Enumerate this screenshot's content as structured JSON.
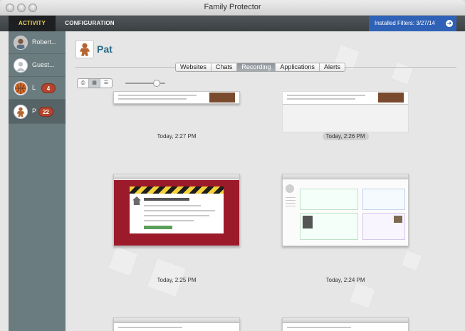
{
  "window": {
    "title": "Family Protector"
  },
  "nav": {
    "activity_label": "ACTIVITY",
    "configuration_label": "CONFIGURATION",
    "filters_banner": "Installed Filters: 3/27/14"
  },
  "sidebar": {
    "users": [
      {
        "name": "Robert...",
        "badge": "",
        "avatar": "photo-avatar"
      },
      {
        "name": "Guest...",
        "badge": "",
        "avatar": "person-silhouette-icon"
      },
      {
        "name": "L",
        "badge": "4",
        "avatar": "basketball-icon"
      },
      {
        "name": "P",
        "badge": "22",
        "avatar": "gingerbread-icon"
      }
    ]
  },
  "profile": {
    "name": "Pat",
    "avatar": "gingerbread-icon"
  },
  "tabs": [
    {
      "label": "Websites",
      "active": false
    },
    {
      "label": "Chats",
      "active": false
    },
    {
      "label": "Recording",
      "active": true
    },
    {
      "label": "Applications",
      "active": false
    },
    {
      "label": "Alerts",
      "active": false
    }
  ],
  "view_controls": {
    "buttons": [
      "print-icon",
      "grid-view-icon",
      "list-view-icon"
    ],
    "active_view": "grid-view-icon",
    "zoom_level": 0.85
  },
  "recordings": [
    {
      "time": "Today, 2:27 PM",
      "kind": "web-page",
      "highlighted": false
    },
    {
      "time": "Today, 2:26 PM",
      "kind": "web-page",
      "highlighted": true
    },
    {
      "time": "Today, 2:25 PM",
      "kind": "blocked-page",
      "highlighted": false
    },
    {
      "time": "Today, 2:24 PM",
      "kind": "wikipedia-page",
      "highlighted": false
    },
    {
      "time": "",
      "kind": "web-page",
      "highlighted": false
    },
    {
      "time": "",
      "kind": "web-page",
      "highlighted": false
    }
  ],
  "colors": {
    "accent_blue": "#2f62b7",
    "activity_tab_text": "#f0d25a",
    "badge_red": "#b5442d",
    "sidebar_bg": "#6b7c80",
    "profile_name": "#2a6a86",
    "blocked_red": "#9b1b2a"
  }
}
